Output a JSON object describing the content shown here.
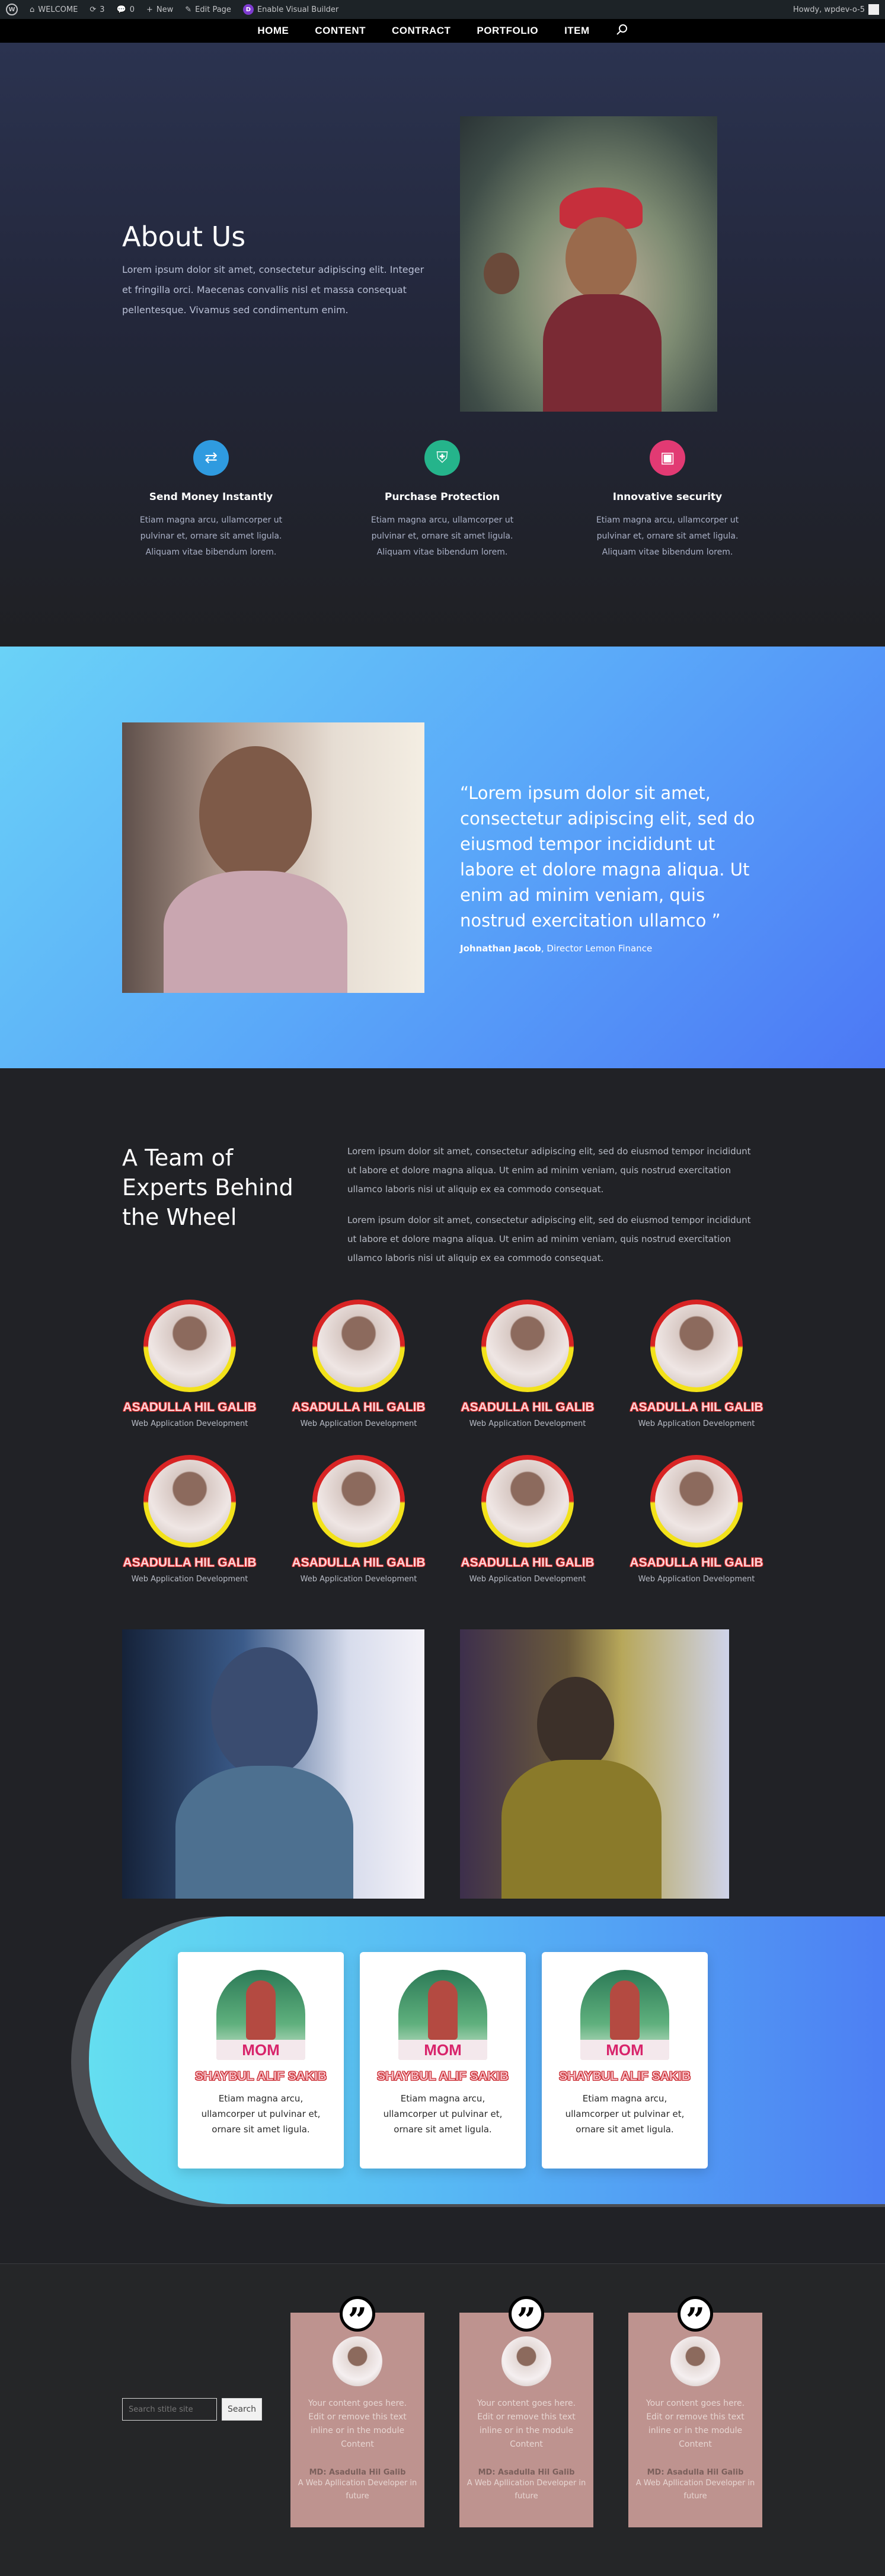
{
  "adminbar": {
    "site_name": "WELCOME",
    "updates_count": "3",
    "comments_count": "0",
    "new_label": "New",
    "edit_page_label": "Edit Page",
    "visual_builder_label": "Enable Visual Builder",
    "howdy_label": "Howdy, wpdev-o-5"
  },
  "nav": {
    "items": [
      {
        "label": "HOME"
      },
      {
        "label": "CONTENT"
      },
      {
        "label": "CONTRACT"
      },
      {
        "label": "PORTFOLIO"
      },
      {
        "label": "ITEM"
      }
    ],
    "search_icon": "search-icon"
  },
  "hero": {
    "title": "About Us",
    "text": "Lorem ipsum dolor sit amet, consectetur adipiscing elit. Integer et fringilla orci. Maecenas convallis nisl et massa consequat pellentesque. Vivamus sed condimentum enim.",
    "features": [
      {
        "icon": "money-transfer-icon",
        "color": "#2f9be0",
        "title": "Send Money Instantly",
        "text": "Etiam magna arcu, ullamcorper ut pulvinar et, ornare sit amet ligula. Aliquam vitae bibendum lorem."
      },
      {
        "icon": "shield-icon",
        "color": "#25b48b",
        "title": "Purchase Protection",
        "text": "Etiam magna arcu, ullamcorper ut pulvinar et, ornare sit amet ligula. Aliquam vitae bibendum lorem."
      },
      {
        "icon": "lock-icon",
        "color": "#e23a73",
        "title": "Innovative security",
        "text": "Etiam magna arcu, ullamcorper ut pulvinar et, ornare sit amet ligula. Aliquam vitae bibendum lorem."
      }
    ]
  },
  "testimonial": {
    "quote": "“Lorem ipsum dolor sit amet, consectetur adipiscing elit, sed do eiusmod tempor incididunt ut labore et dolore magna aliqua. Ut enim ad minim veniam, quis nostrud exercitation ullamco ”",
    "author": "Johnathan Jacob",
    "author_role": ", Director Lemon Finance"
  },
  "team": {
    "title": "A Team of Experts Behind the Wheel",
    "paragraphs": [
      "Lorem ipsum dolor sit amet, consectetur adipiscing elit, sed do eiusmod tempor incididunt ut labore et dolore magna aliqua. Ut enim ad minim veniam, quis nostrud exercitation ullamco laboris nisi ut aliquip ex ea commodo consequat.",
      "Lorem ipsum dolor sit amet, consectetur adipiscing elit, sed do eiusmod tempor incididunt ut labore et dolore magna aliqua. Ut enim ad minim veniam, quis nostrud exercitation ullamco laboris nisi ut aliquip ex ea commodo consequat."
    ],
    "members": [
      {
        "name": "ASADULLA HIL GALIB",
        "role": "Web Application Development"
      },
      {
        "name": "ASADULLA HIL GALIB",
        "role": "Web Application Development"
      },
      {
        "name": "ASADULLA HIL GALIB",
        "role": "Web Application Development"
      },
      {
        "name": "ASADULLA HIL GALIB",
        "role": "Web Application Development"
      },
      {
        "name": "ASADULLA HIL GALIB",
        "role": "Web Application Development"
      },
      {
        "name": "ASADULLA HIL GALIB",
        "role": "Web Application Development"
      },
      {
        "name": "ASADULLA HIL GALIB",
        "role": "Web Application Development"
      },
      {
        "name": "ASADULLA HIL GALIB",
        "role": "Web Application Development"
      }
    ]
  },
  "cards": [
    {
      "badge": "MOM",
      "name": "SHAYBUL ALIF SAKIB",
      "text": "Etiam magna arcu, ullamcorper ut pulvinar et, ornare sit amet ligula."
    },
    {
      "badge": "MOM",
      "name": "SHAYBUL ALIF SAKIB",
      "text": "Etiam magna arcu, ullamcorper ut pulvinar et, ornare sit amet ligula."
    },
    {
      "badge": "MOM",
      "name": "SHAYBUL ALIF SAKIB",
      "text": "Etiam magna arcu, ullamcorper ut pulvinar et, ornare sit amet ligula."
    }
  ],
  "footer": {
    "search_placeholder": "Search stitle site",
    "search_button": "Search",
    "testimonials": [
      {
        "text": "Your content goes here. Edit or remove this text inline or in the module Content",
        "name": "MD: Asadulla Hil Galib",
        "role": "A Web Apllication Developer in future"
      },
      {
        "text": "Your content goes here. Edit or remove this text inline or in the module Content",
        "name": "MD: Asadulla Hil Galib",
        "role": "A Web Apllication Developer in future"
      },
      {
        "text": "Your content goes here. Edit or remove this text inline or in the module Content",
        "name": "MD: Asadulla Hil Galib",
        "role": "A Web Apllication Developer in future"
      }
    ]
  }
}
